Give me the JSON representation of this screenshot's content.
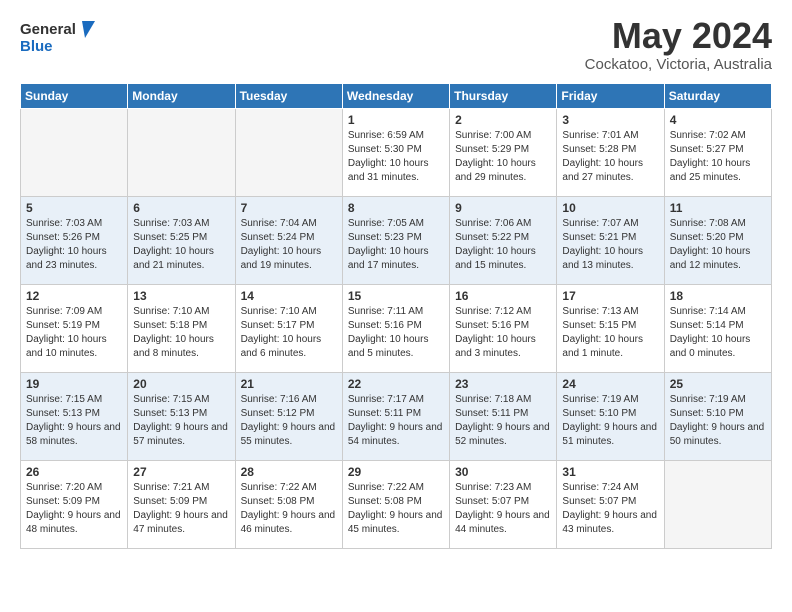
{
  "header": {
    "logo_line1": "General",
    "logo_line2": "Blue",
    "month_title": "May 2024",
    "location": "Cockatoo, Victoria, Australia"
  },
  "days_of_week": [
    "Sunday",
    "Monday",
    "Tuesday",
    "Wednesday",
    "Thursday",
    "Friday",
    "Saturday"
  ],
  "weeks": [
    [
      {
        "day": "",
        "empty": true
      },
      {
        "day": "",
        "empty": true
      },
      {
        "day": "",
        "empty": true
      },
      {
        "day": "1",
        "sunrise": "6:59 AM",
        "sunset": "5:30 PM",
        "daylight": "10 hours and 31 minutes."
      },
      {
        "day": "2",
        "sunrise": "7:00 AM",
        "sunset": "5:29 PM",
        "daylight": "10 hours and 29 minutes."
      },
      {
        "day": "3",
        "sunrise": "7:01 AM",
        "sunset": "5:28 PM",
        "daylight": "10 hours and 27 minutes."
      },
      {
        "day": "4",
        "sunrise": "7:02 AM",
        "sunset": "5:27 PM",
        "daylight": "10 hours and 25 minutes."
      }
    ],
    [
      {
        "day": "5",
        "sunrise": "7:03 AM",
        "sunset": "5:26 PM",
        "daylight": "10 hours and 23 minutes."
      },
      {
        "day": "6",
        "sunrise": "7:03 AM",
        "sunset": "5:25 PM",
        "daylight": "10 hours and 21 minutes."
      },
      {
        "day": "7",
        "sunrise": "7:04 AM",
        "sunset": "5:24 PM",
        "daylight": "10 hours and 19 minutes."
      },
      {
        "day": "8",
        "sunrise": "7:05 AM",
        "sunset": "5:23 PM",
        "daylight": "10 hours and 17 minutes."
      },
      {
        "day": "9",
        "sunrise": "7:06 AM",
        "sunset": "5:22 PM",
        "daylight": "10 hours and 15 minutes."
      },
      {
        "day": "10",
        "sunrise": "7:07 AM",
        "sunset": "5:21 PM",
        "daylight": "10 hours and 13 minutes."
      },
      {
        "day": "11",
        "sunrise": "7:08 AM",
        "sunset": "5:20 PM",
        "daylight": "10 hours and 12 minutes."
      }
    ],
    [
      {
        "day": "12",
        "sunrise": "7:09 AM",
        "sunset": "5:19 PM",
        "daylight": "10 hours and 10 minutes."
      },
      {
        "day": "13",
        "sunrise": "7:10 AM",
        "sunset": "5:18 PM",
        "daylight": "10 hours and 8 minutes."
      },
      {
        "day": "14",
        "sunrise": "7:10 AM",
        "sunset": "5:17 PM",
        "daylight": "10 hours and 6 minutes."
      },
      {
        "day": "15",
        "sunrise": "7:11 AM",
        "sunset": "5:16 PM",
        "daylight": "10 hours and 5 minutes."
      },
      {
        "day": "16",
        "sunrise": "7:12 AM",
        "sunset": "5:16 PM",
        "daylight": "10 hours and 3 minutes."
      },
      {
        "day": "17",
        "sunrise": "7:13 AM",
        "sunset": "5:15 PM",
        "daylight": "10 hours and 1 minute."
      },
      {
        "day": "18",
        "sunrise": "7:14 AM",
        "sunset": "5:14 PM",
        "daylight": "10 hours and 0 minutes."
      }
    ],
    [
      {
        "day": "19",
        "sunrise": "7:15 AM",
        "sunset": "5:13 PM",
        "daylight": "9 hours and 58 minutes."
      },
      {
        "day": "20",
        "sunrise": "7:15 AM",
        "sunset": "5:13 PM",
        "daylight": "9 hours and 57 minutes."
      },
      {
        "day": "21",
        "sunrise": "7:16 AM",
        "sunset": "5:12 PM",
        "daylight": "9 hours and 55 minutes."
      },
      {
        "day": "22",
        "sunrise": "7:17 AM",
        "sunset": "5:11 PM",
        "daylight": "9 hours and 54 minutes."
      },
      {
        "day": "23",
        "sunrise": "7:18 AM",
        "sunset": "5:11 PM",
        "daylight": "9 hours and 52 minutes."
      },
      {
        "day": "24",
        "sunrise": "7:19 AM",
        "sunset": "5:10 PM",
        "daylight": "9 hours and 51 minutes."
      },
      {
        "day": "25",
        "sunrise": "7:19 AM",
        "sunset": "5:10 PM",
        "daylight": "9 hours and 50 minutes."
      }
    ],
    [
      {
        "day": "26",
        "sunrise": "7:20 AM",
        "sunset": "5:09 PM",
        "daylight": "9 hours and 48 minutes."
      },
      {
        "day": "27",
        "sunrise": "7:21 AM",
        "sunset": "5:09 PM",
        "daylight": "9 hours and 47 minutes."
      },
      {
        "day": "28",
        "sunrise": "7:22 AM",
        "sunset": "5:08 PM",
        "daylight": "9 hours and 46 minutes."
      },
      {
        "day": "29",
        "sunrise": "7:22 AM",
        "sunset": "5:08 PM",
        "daylight": "9 hours and 45 minutes."
      },
      {
        "day": "30",
        "sunrise": "7:23 AM",
        "sunset": "5:07 PM",
        "daylight": "9 hours and 44 minutes."
      },
      {
        "day": "31",
        "sunrise": "7:24 AM",
        "sunset": "5:07 PM",
        "daylight": "9 hours and 43 minutes."
      },
      {
        "day": "",
        "empty": true
      }
    ]
  ]
}
